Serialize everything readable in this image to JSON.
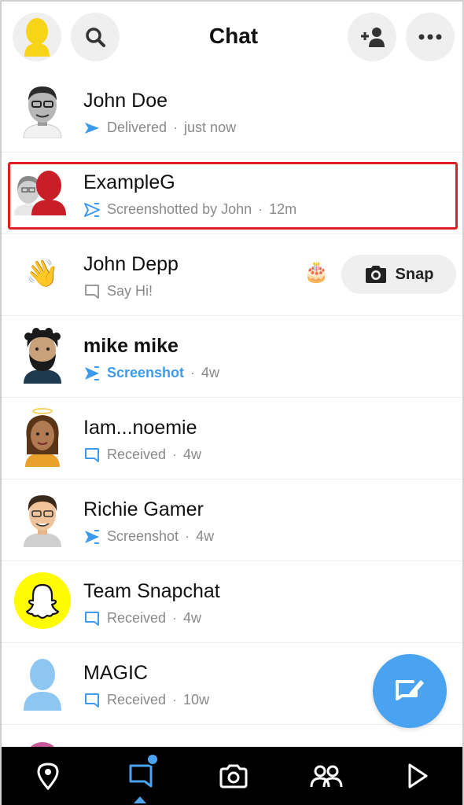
{
  "header": {
    "title": "Chat",
    "profile_icon": "bitmoji-avatar-icon",
    "search_icon": "search-icon",
    "add_friend_icon": "add-friend-icon",
    "more_icon": "more-icon"
  },
  "chats": [
    {
      "name": "John Doe",
      "status_icon": "delivered-arrow-icon",
      "status": "Delivered",
      "time": "just now"
    },
    {
      "name": "ExampleG",
      "status_icon": "screenshot-outline-icon",
      "status": "Screenshotted by John",
      "time": "12m"
    },
    {
      "name": "John Depp",
      "status_icon": "chat-bubble-outline-icon",
      "status": "Say Hi!",
      "badge": "🎂",
      "action": "Snap"
    },
    {
      "name": "mike mike",
      "status_icon": "screenshot-filled-icon",
      "status": "Screenshot",
      "time": "4w"
    },
    {
      "name": "Iam...noemie",
      "status_icon": "chat-bubble-icon",
      "status": "Received",
      "time": "4w"
    },
    {
      "name": "Richie Gamer",
      "status_icon": "screenshot-filled-icon",
      "status": "Screenshot",
      "time": "4w"
    },
    {
      "name": "Team Snapchat",
      "status_icon": "chat-bubble-icon",
      "status": "Received",
      "time": "4w"
    },
    {
      "name": "MAGIC",
      "status_icon": "chat-bubble-icon",
      "status": "Received",
      "time": "10w"
    }
  ],
  "nav": {
    "map_icon": "map-pin-icon",
    "chat_icon": "chat-icon",
    "camera_icon": "camera-icon",
    "friends_icon": "friends-icon",
    "discover_icon": "play-icon"
  },
  "colors": {
    "accent": "#4aa3f0",
    "highlight_border": "#e02020",
    "nav_bg": "#000000"
  }
}
